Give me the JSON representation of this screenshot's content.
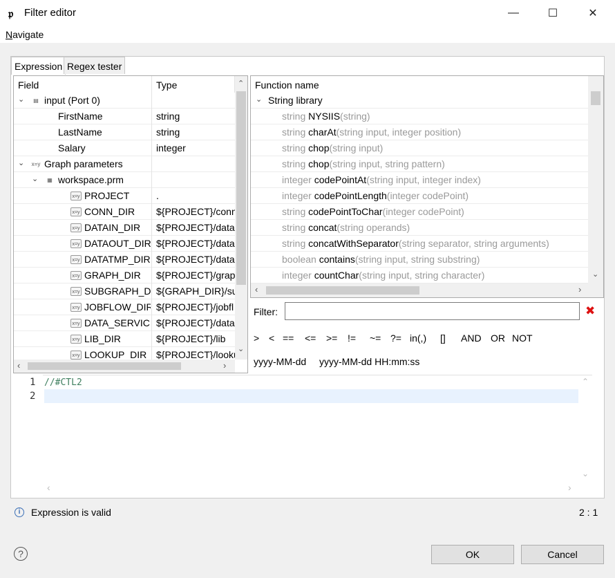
{
  "window": {
    "title": "Filter editor",
    "min_glyph": "—",
    "max_glyph": "☐",
    "close_glyph": "✕"
  },
  "menu": {
    "navigate": "Navigate"
  },
  "tabs": [
    {
      "label": "Expression",
      "active": true
    },
    {
      "label": "Regex tester",
      "active": false
    }
  ],
  "field_tree": {
    "headers": {
      "field": "Field",
      "type": "Type"
    },
    "rows": [
      {
        "field": "input (Port 0)",
        "type": "",
        "level": 0,
        "expanded": true,
        "icon": "record-icon"
      },
      {
        "field": "FirstName",
        "type": "string",
        "level": 2,
        "icon": ""
      },
      {
        "field": "LastName",
        "type": "string",
        "level": 2,
        "icon": ""
      },
      {
        "field": "Salary",
        "type": "integer",
        "level": 2,
        "icon": ""
      },
      {
        "field": "Graph parameters",
        "type": "",
        "level": 0,
        "expanded": true,
        "icon": "parameters-icon"
      },
      {
        "field": "workspace.prm",
        "type": "",
        "level": 1,
        "expanded": true,
        "icon": "prm-file-icon"
      },
      {
        "field": "PROJECT",
        "type": ".",
        "level": 2,
        "icon": "param-icon"
      },
      {
        "field": "CONN_DIR",
        "type": "${PROJECT}/conn",
        "level": 2,
        "icon": "param-icon"
      },
      {
        "field": "DATAIN_DIR",
        "type": "${PROJECT}/data",
        "level": 2,
        "icon": "param-icon"
      },
      {
        "field": "DATAOUT_DIR",
        "type": "${PROJECT}/data",
        "level": 2,
        "icon": "param-icon"
      },
      {
        "field": "DATATMP_DIR",
        "type": "${PROJECT}/data",
        "level": 2,
        "icon": "param-icon"
      },
      {
        "field": "GRAPH_DIR",
        "type": "${PROJECT}/grap",
        "level": 2,
        "icon": "param-icon"
      },
      {
        "field": "SUBGRAPH_DIR",
        "type": "${GRAPH_DIR}/su",
        "level": 2,
        "icon": "param-icon"
      },
      {
        "field": "JOBFLOW_DIR",
        "type": "${PROJECT}/jobfl",
        "level": 2,
        "icon": "param-icon"
      },
      {
        "field": "DATA_SERVICE_D",
        "type": "${PROJECT}/data",
        "level": 2,
        "icon": "param-icon"
      },
      {
        "field": "LIB_DIR",
        "type": "${PROJECT}/lib",
        "level": 2,
        "icon": "param-icon"
      },
      {
        "field": "LOOKUP_DIR",
        "type": "${PROJECT}/looku",
        "level": 2,
        "icon": "param-icon"
      }
    ]
  },
  "functions": {
    "header": "Function name",
    "group": "String library",
    "rows": [
      {
        "ret": "string",
        "name": "NYSIIS",
        "args": "(string)"
      },
      {
        "ret": "string",
        "name": "charAt",
        "args": "(string input, integer position)"
      },
      {
        "ret": "string",
        "name": "chop",
        "args": "(string input)"
      },
      {
        "ret": "string",
        "name": "chop",
        "args": "(string input, string pattern)"
      },
      {
        "ret": "integer",
        "name": "codePointAt",
        "args": "(string input, integer index)"
      },
      {
        "ret": "integer",
        "name": "codePointLength",
        "args": "(integer codePoint)"
      },
      {
        "ret": "string",
        "name": "codePointToChar",
        "args": "(integer codePoint)"
      },
      {
        "ret": "string",
        "name": "concat",
        "args": "(string operands)"
      },
      {
        "ret": "string",
        "name": "concatWithSeparator",
        "args": "(string separator, string arguments)"
      },
      {
        "ret": "boolean",
        "name": "contains",
        "args": "(string input, string substring)"
      },
      {
        "ret": "integer",
        "name": "countChar",
        "args": "(string input, string character)"
      }
    ]
  },
  "filter": {
    "label": "Filter:",
    "value": "",
    "clear_glyph": "✖"
  },
  "operators": [
    ">",
    "<",
    "==",
    "<=",
    ">=",
    "!=",
    "~=",
    "?=",
    "in(,)",
    "[]",
    "AND",
    "OR",
    "NOT"
  ],
  "date_formats": [
    "yyyy-MM-dd",
    "yyyy-MM-dd HH:mm:ss"
  ],
  "editor": {
    "lines": [
      {
        "no": "1",
        "text": "//#CTL2"
      },
      {
        "no": "2",
        "text": ""
      }
    ]
  },
  "status": {
    "icon_glyph": "i",
    "text": "Expression is valid",
    "position": "2 : 1"
  },
  "buttons": {
    "help_glyph": "?",
    "ok": "OK",
    "cancel": "Cancel"
  }
}
